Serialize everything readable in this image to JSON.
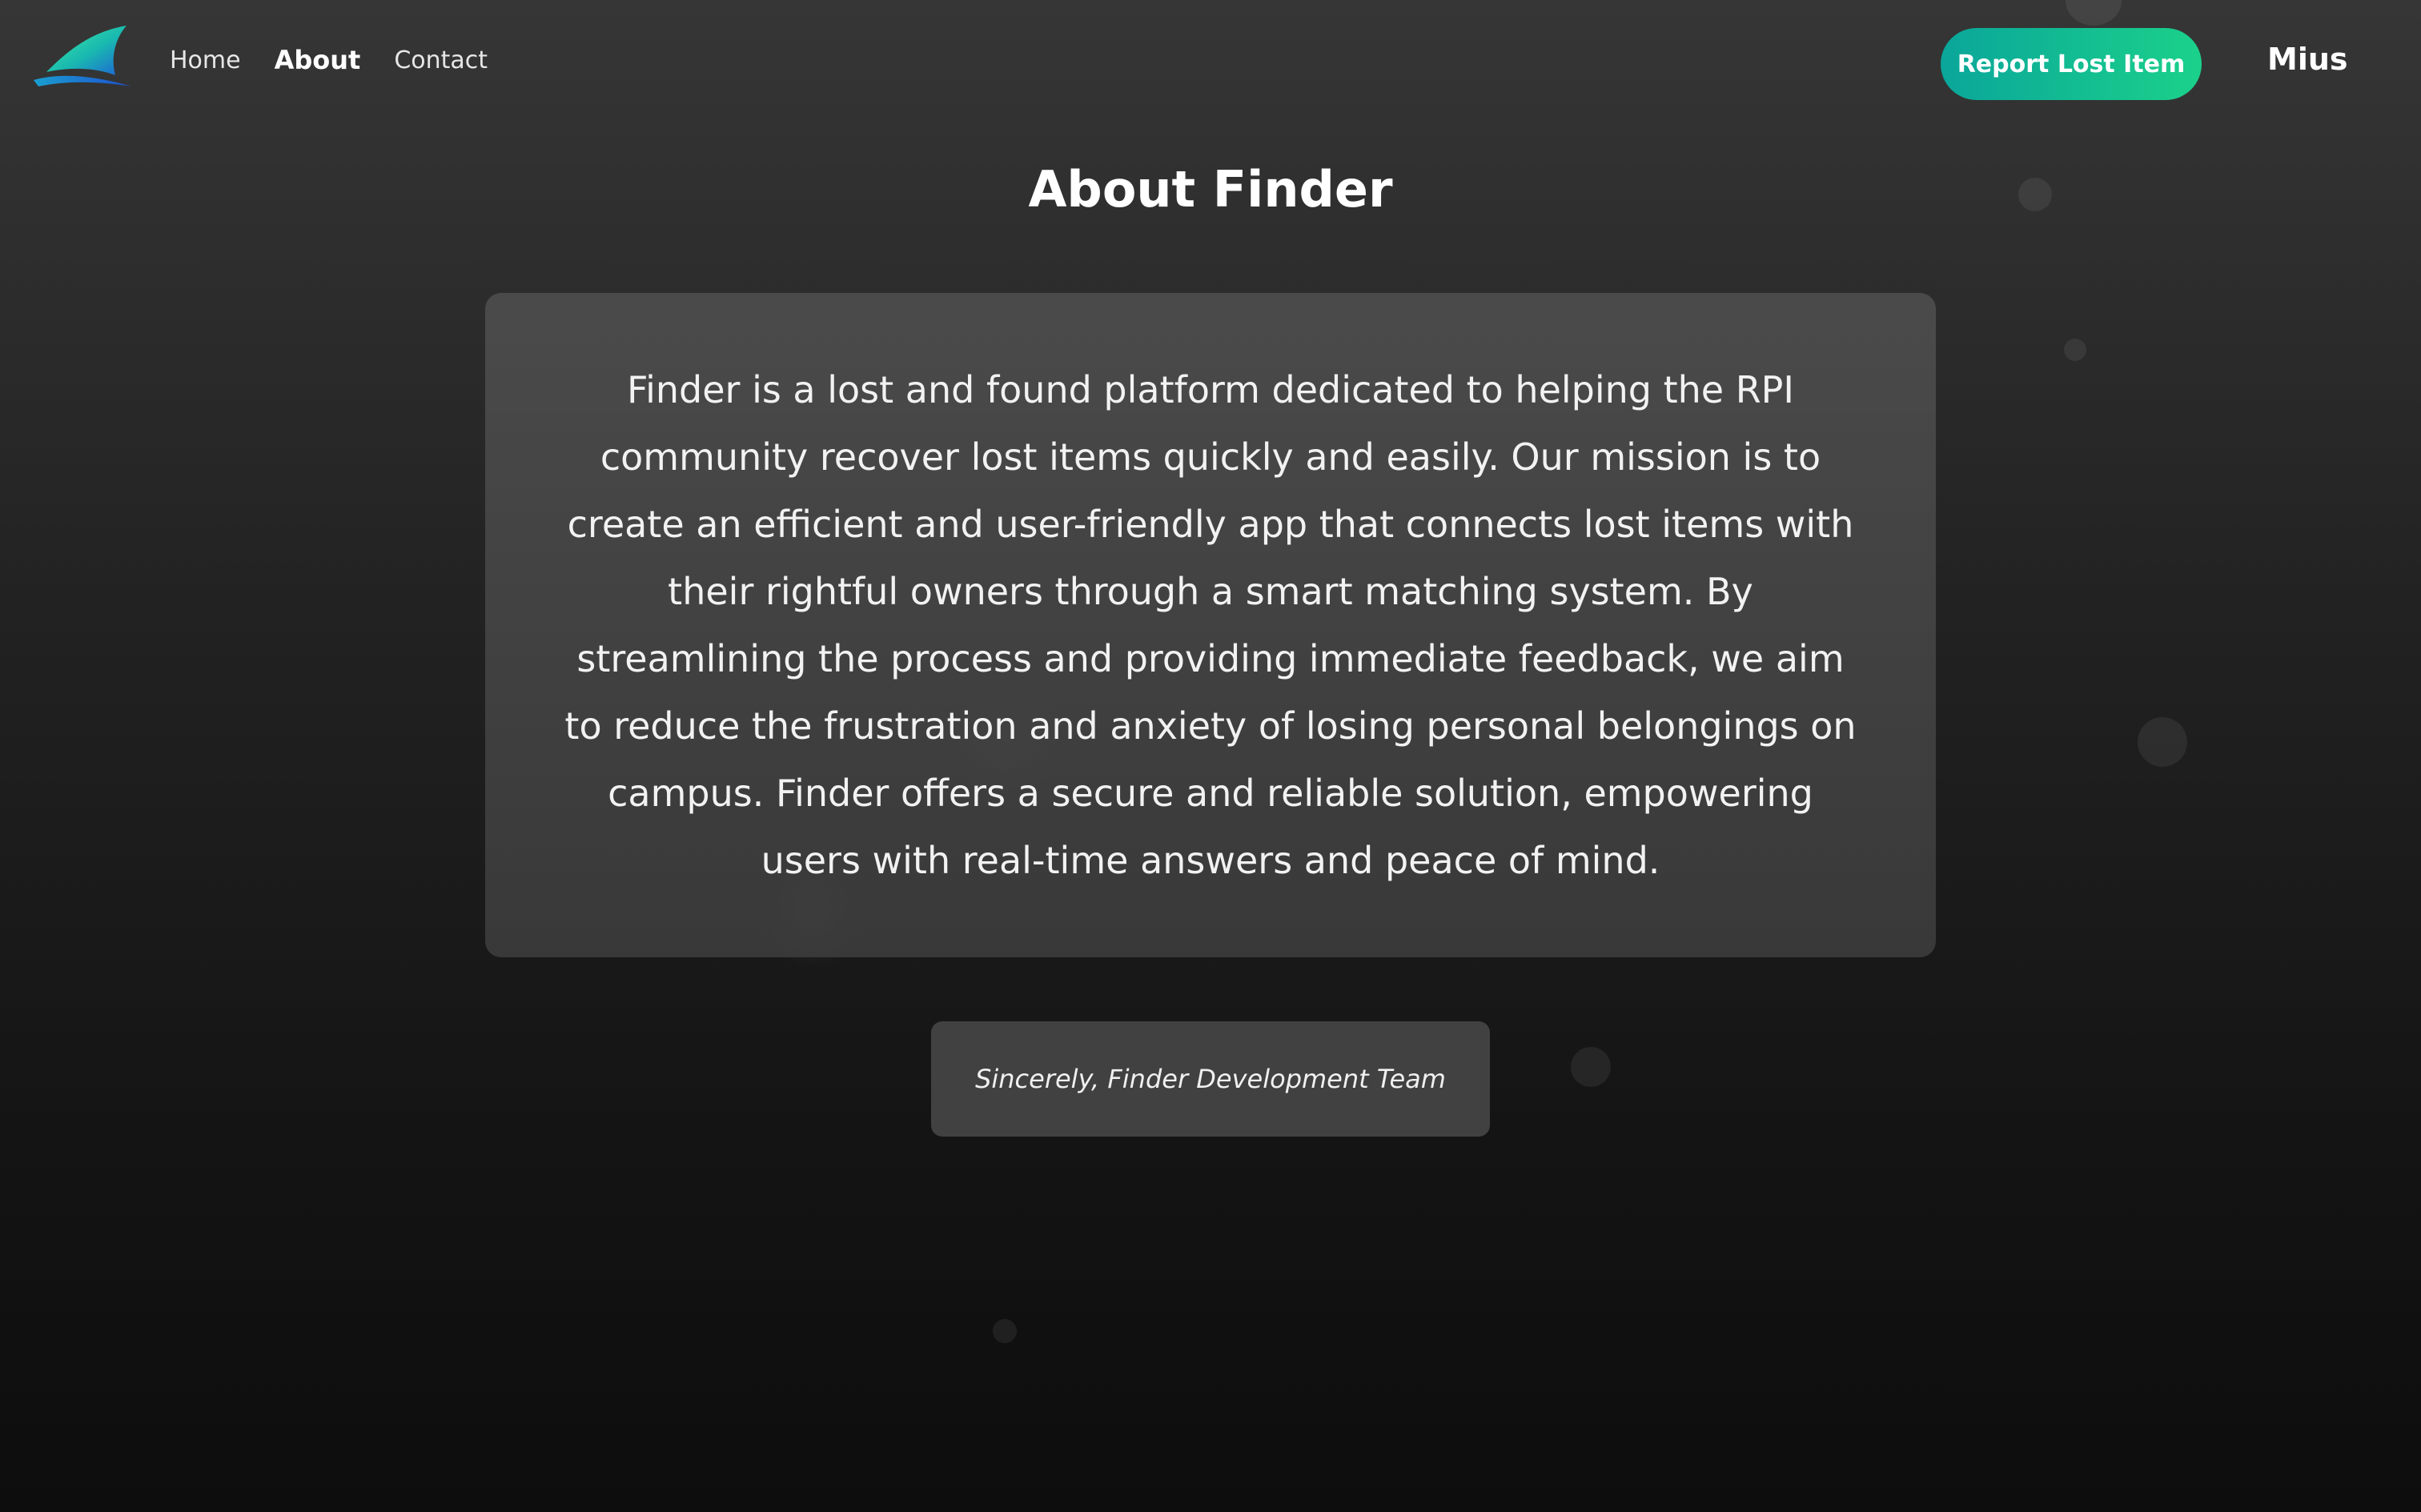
{
  "navbar": {
    "links": [
      {
        "label": "Home"
      },
      {
        "label": "About"
      },
      {
        "label": "Contact"
      }
    ],
    "report_button_label": "Report Lost Item",
    "user_name": "Mius"
  },
  "main": {
    "title": "About Finder",
    "description": "Finder is a lost and found platform dedicated to helping the RPI community recover lost items quickly and easily. Our mission is to create an efficient and user-friendly app that connects lost items with their rightful owners through a smart matching system. By streamlining the process and providing immediate feedback, we aim to reduce the frustration and anxiety of losing personal belongings on campus. Finder offers a secure and reliable solution, empowering users with real-time answers and peace of mind.",
    "signature": "Sincerely, Finder Development Team"
  },
  "colors": {
    "accent_gradient_start": "#0aa69a",
    "accent_gradient_end": "#1bd18a",
    "logo_start": "#2ee6a6",
    "logo_end": "#1e5fd6"
  },
  "icons": {
    "logo": "shark-fin-logo-icon"
  }
}
